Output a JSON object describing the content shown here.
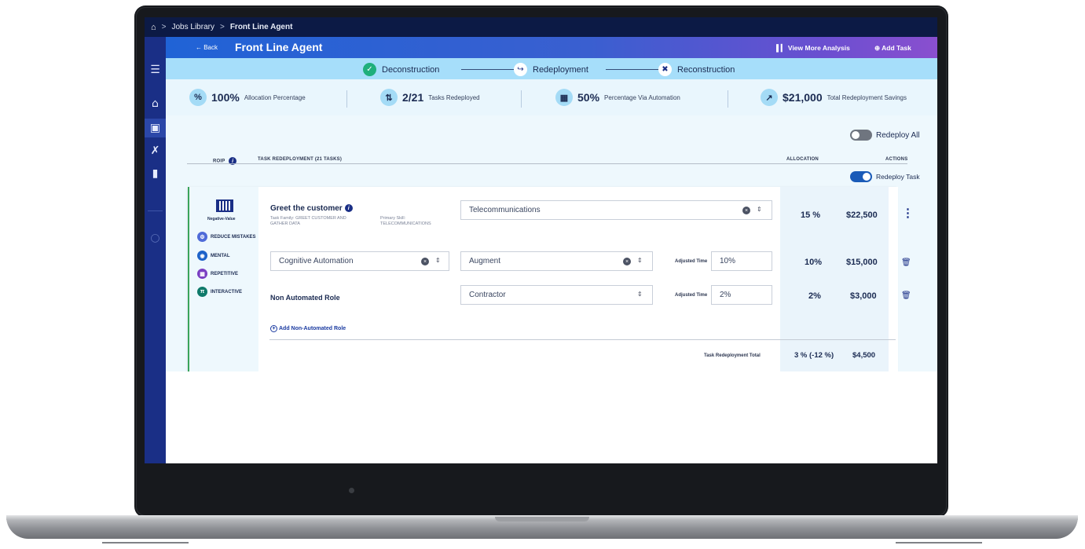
{
  "breadcrumb": {
    "items": [
      "Jobs Library",
      "Front Line Agent"
    ],
    "separator": ">"
  },
  "header": {
    "back_label": "← Back",
    "title": "Front Line Agent",
    "analysis_label": "View More Analysis",
    "add_task_label": "Add Task"
  },
  "steps": [
    {
      "label": "Deconstruction",
      "icon": "check-icon",
      "color": "#1faf7c"
    },
    {
      "label": "Redeployment",
      "icon": "redeploy-icon",
      "color": "#ffffff"
    },
    {
      "label": "Reconstruction",
      "icon": "tools-icon",
      "color": "#ffffff"
    }
  ],
  "stats": [
    {
      "icon": "percent-icon",
      "value": "100%",
      "label": "Allocation Percentage"
    },
    {
      "icon": "redeploy-icon",
      "value": "2/21",
      "label": "Tasks Redeployed"
    },
    {
      "icon": "chip-icon",
      "value": "50%",
      "label": "Percentage Via Automation"
    },
    {
      "icon": "savings-icon",
      "value": "$21,000",
      "label": "Total Redeployment Savings"
    }
  ],
  "toggles": {
    "redeploy_all": {
      "label": "Redeploy All",
      "on": false
    },
    "redeploy_task": {
      "label": "Redeploy Task",
      "on": true
    }
  },
  "columns": {
    "roip": "ROIP",
    "task": "TASK REDEPLOYMENT (21 TASKS)",
    "allocation": "ALLOCATION",
    "actions": "ACTIONS"
  },
  "task": {
    "roip_label": "Negative-Value",
    "title": "Greet the customer",
    "family": "Task Family: GREET CUSTOMER AND GATHER DATA",
    "skill": "Primary Skill: TELECOMMUNICATIONS",
    "badges": [
      {
        "label": "REDUCE MISTAKES",
        "icon": "reduce-mistakes-icon",
        "color": "#4f6bd8"
      },
      {
        "label": "MENTAL",
        "icon": "brain-icon",
        "color": "#1e63c9"
      },
      {
        "label": "REPETITIVE",
        "icon": "grid-icon",
        "color": "#7a3fc2"
      },
      {
        "label": "INTERACTIVE",
        "icon": "people-icon",
        "color": "#0f7a6a"
      }
    ],
    "rows": [
      {
        "select1": "Telecommunications",
        "pct": "15 %",
        "amount": "$22,500"
      },
      {
        "select1": "Cognitive Automation",
        "select2": "Augment",
        "adjusted_label": "Adjusted Time",
        "adjusted_value": "10%",
        "pct": "10%",
        "amount": "$15,000"
      },
      {
        "role": "Non Automated Role",
        "select2": "Contractor",
        "adjusted_label": "Adjusted Time",
        "adjusted_value": "2%",
        "pct": "2%",
        "amount": "$3,000"
      }
    ],
    "add_role": "Add Non-Automated Role",
    "total_label": "Task Redeployment Total",
    "total_pct": "3 % (-12 %)",
    "total_amount": "$4,500"
  }
}
